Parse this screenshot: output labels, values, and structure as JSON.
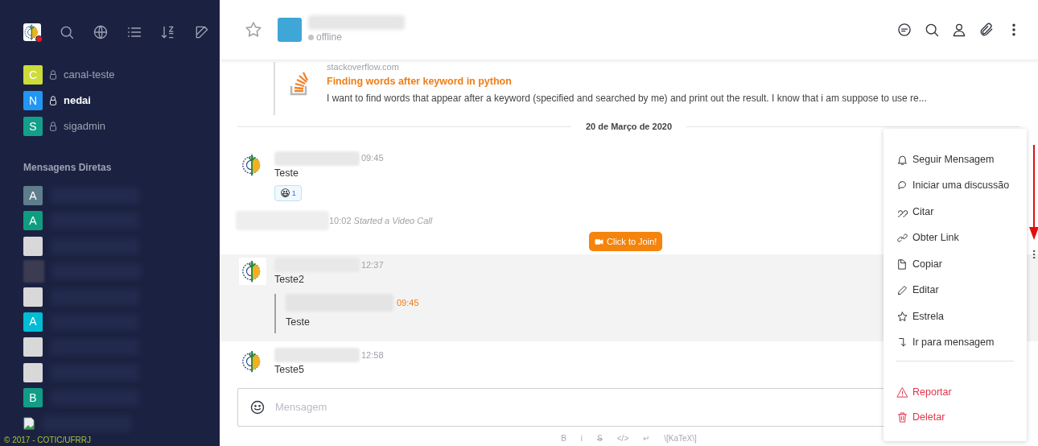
{
  "sidebar": {
    "channels": [
      {
        "letter": "C",
        "color": "#cddc39",
        "name": "canal-teste",
        "selected": false
      },
      {
        "letter": "N",
        "color": "#2196f3",
        "name": "nedai",
        "selected": true
      },
      {
        "letter": "S",
        "color": "#139f8a",
        "name": "sigadmin",
        "selected": false
      }
    ],
    "direct_heading": "Mensagens Diretas",
    "direct": [
      {
        "kind": "letter",
        "letter": "A",
        "color": "#607d8b"
      },
      {
        "kind": "letter",
        "letter": "A",
        "color": "#0f9d80"
      },
      {
        "kind": "image"
      },
      {
        "kind": "blurred"
      },
      {
        "kind": "image"
      },
      {
        "kind": "letter",
        "letter": "A",
        "color": "#00bcd4"
      },
      {
        "kind": "image"
      },
      {
        "kind": "image"
      },
      {
        "kind": "letter",
        "letter": "B",
        "color": "#119d86"
      },
      {
        "kind": "broken"
      }
    ],
    "footer": "© 2017 - COTIC/UFRRJ"
  },
  "header": {
    "status": "offline"
  },
  "preview": {
    "site": "stackoverflow.com",
    "title": "Finding words after keyword in python",
    "description": "I want to find words that appear after a keyword (specified and searched by me) and print out the result. I know that i am suppose to use re..."
  },
  "date_divider": "20 de Março de 2020",
  "messages": [
    {
      "kind": "message",
      "time": "09:45",
      "text": "Teste",
      "highlighted": false,
      "reaction": {
        "emoji": "😆",
        "count": "1"
      }
    },
    {
      "kind": "system",
      "time": "10:02",
      "text": "Started a Video Call",
      "button": "Click to Join!"
    },
    {
      "kind": "message",
      "time": "12:37",
      "text": "Teste2",
      "highlighted": true,
      "quote": {
        "time": "09:45",
        "text": "Teste"
      }
    },
    {
      "kind": "message",
      "time": "12:58",
      "text": "Teste5",
      "highlighted": false
    }
  ],
  "composer": {
    "placeholder": "Mensagem",
    "format": [
      "B",
      "i",
      "S",
      "</>",
      "↵",
      "\\[KaTeX\\]"
    ]
  },
  "menu": {
    "items": [
      {
        "kind": "normal",
        "label": "Seguir Mensagem"
      },
      {
        "kind": "normal",
        "label": "Iniciar uma discussão"
      },
      {
        "kind": "normal",
        "label": "Citar"
      },
      {
        "kind": "normal",
        "label": "Obter Link"
      },
      {
        "kind": "normal",
        "label": "Copiar"
      },
      {
        "kind": "normal",
        "label": "Editar"
      },
      {
        "kind": "normal",
        "label": "Estrela"
      },
      {
        "kind": "normal",
        "label": "Ir para mensagem"
      },
      {
        "kind": "danger",
        "label": "Reportar"
      },
      {
        "kind": "danger",
        "label": "Deletar"
      }
    ]
  }
}
